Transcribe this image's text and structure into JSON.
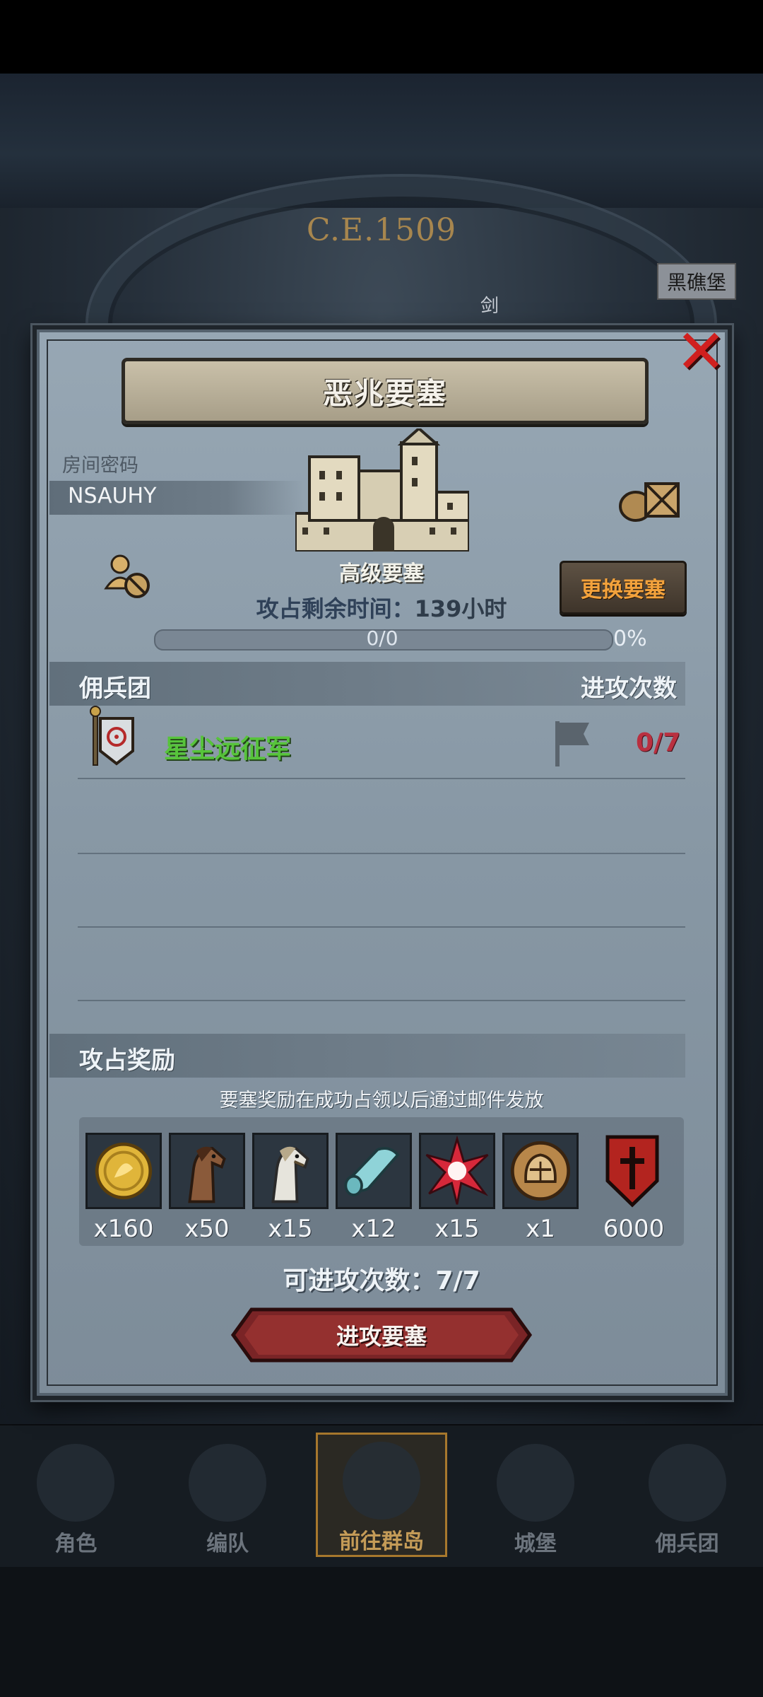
{
  "background": {
    "year_text": "C.E.1509",
    "location_tag": "黑礁堡",
    "location_tag_2": "剑"
  },
  "modal": {
    "title": "恶兆要塞",
    "room": {
      "label": "房间密码",
      "code": "NSAUHY"
    },
    "castle": {
      "name": "高级要塞"
    },
    "change_button": "更换要塞",
    "occupy_time": {
      "label": "攻占剩余时间：",
      "value": "139",
      "unit": "小时"
    },
    "progress": {
      "text": "0/0",
      "percent_text": "0%",
      "fraction": 0
    },
    "mercenary_section": {
      "left_header": "佣兵团",
      "right_header": "进攻次数",
      "rows": [
        {
          "name": "星尘远征军",
          "attacks": "0/7"
        }
      ]
    },
    "reward_section": {
      "title": "攻占奖励",
      "note": "要塞奖励在成功占领以后通过邮件发放",
      "items": [
        {
          "icon": "gold-coin-icon",
          "qty": "x160"
        },
        {
          "icon": "brown-horse-icon",
          "qty": "x50"
        },
        {
          "icon": "white-horse-icon",
          "qty": "x15"
        },
        {
          "icon": "cloth-roll-icon",
          "qty": "x12"
        },
        {
          "icon": "red-star-crystal-icon",
          "qty": "x15"
        },
        {
          "icon": "knight-helmet-medal-icon",
          "qty": "x1"
        },
        {
          "icon": "red-shield-emblem-icon",
          "qty": "6000"
        }
      ]
    },
    "attacks_available": {
      "label": "可进攻次数：",
      "value": "7/7"
    },
    "attack_button": "进攻要塞"
  },
  "bottom_nav": {
    "items": [
      {
        "label": "角色",
        "active": false
      },
      {
        "label": "编队",
        "active": false
      },
      {
        "label": "前往群岛",
        "active": true
      },
      {
        "label": "城堡",
        "active": false
      },
      {
        "label": "佣兵团",
        "active": false
      }
    ]
  },
  "colors": {
    "merc_name": "#57c43b",
    "attack_count": "#b93040",
    "change_button_text": "#f3a23c",
    "close_x": "#d0201f"
  }
}
